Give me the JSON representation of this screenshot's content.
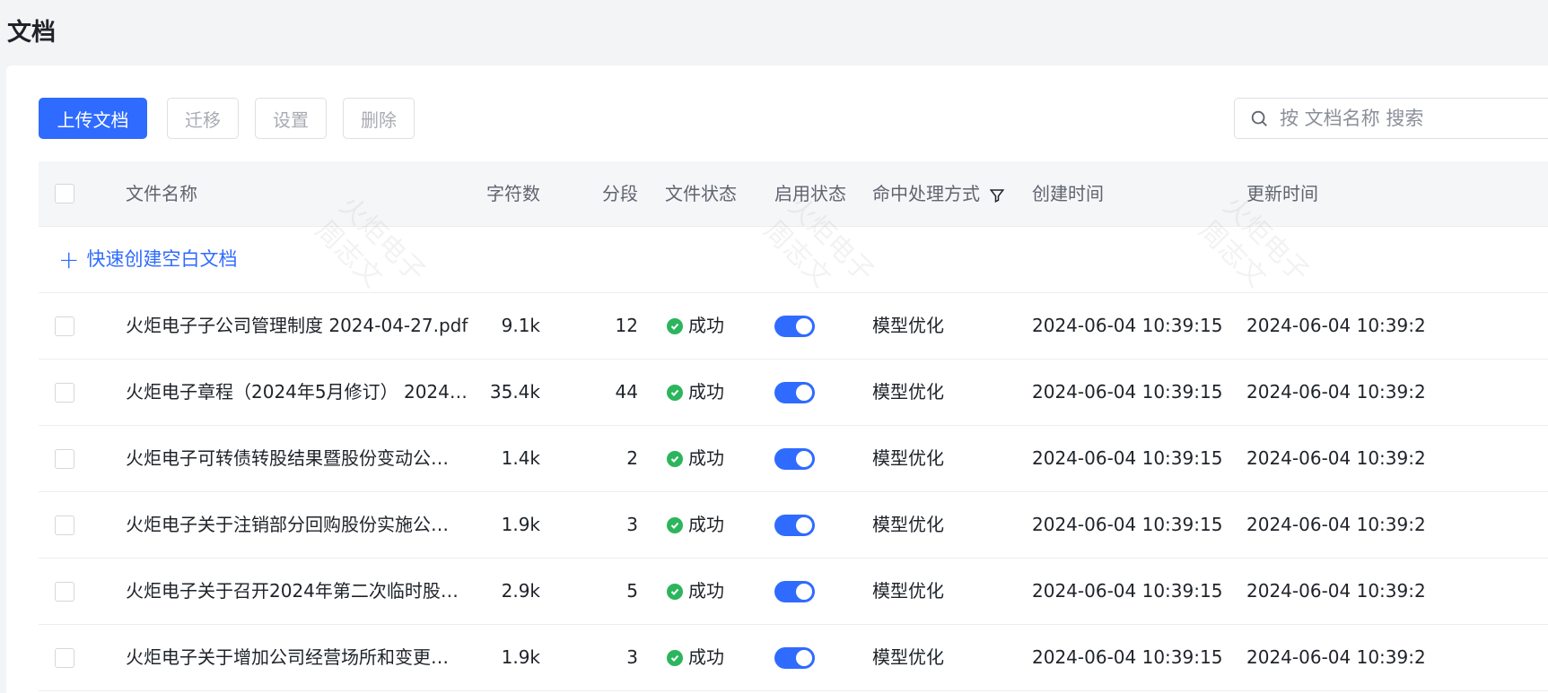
{
  "page": {
    "title": "文档"
  },
  "toolbar": {
    "upload_label": "上传文档",
    "migrate_label": "迁移",
    "settings_label": "设置",
    "delete_label": "删除"
  },
  "search": {
    "placeholder": "按 文档名称 搜索",
    "value": ""
  },
  "table": {
    "headers": {
      "name": "文件名称",
      "chars": "字符数",
      "segments": "分段",
      "file_status": "文件状态",
      "enable_status": "启用状态",
      "hit_method": "命中处理方式",
      "created": "创建时间",
      "updated": "更新时间"
    },
    "create_blank_label": "快速创建空白文档",
    "rows": [
      {
        "name": "火炬电子子公司管理制度 2024-04-27.pdf",
        "chars": "9.1k",
        "segments": "12",
        "status": "成功",
        "enabled": true,
        "method": "模型优化",
        "created": "2024-06-04 10:39:15",
        "updated": "2024-06-04 10:39:2"
      },
      {
        "name": "火炬电子章程（2024年5月修订） 2024…",
        "chars": "35.4k",
        "segments": "44",
        "status": "成功",
        "enabled": true,
        "method": "模型优化",
        "created": "2024-06-04 10:39:15",
        "updated": "2024-06-04 10:39:2"
      },
      {
        "name": "火炬电子可转债转股结果暨股份变动公…",
        "chars": "1.4k",
        "segments": "2",
        "status": "成功",
        "enabled": true,
        "method": "模型优化",
        "created": "2024-06-04 10:39:15",
        "updated": "2024-06-04 10:39:2"
      },
      {
        "name": "火炬电子关于注销部分回购股份实施公…",
        "chars": "1.9k",
        "segments": "3",
        "status": "成功",
        "enabled": true,
        "method": "模型优化",
        "created": "2024-06-04 10:39:15",
        "updated": "2024-06-04 10:39:2"
      },
      {
        "name": "火炬电子关于召开2024年第二次临时股…",
        "chars": "2.9k",
        "segments": "5",
        "status": "成功",
        "enabled": true,
        "method": "模型优化",
        "created": "2024-06-04 10:39:15",
        "updated": "2024-06-04 10:39:2"
      },
      {
        "name": "火炬电子关于增加公司经营场所和变更…",
        "chars": "1.9k",
        "segments": "3",
        "status": "成功",
        "enabled": true,
        "method": "模型优化",
        "created": "2024-06-04 10:39:15",
        "updated": "2024-06-04 10:39:2"
      }
    ]
  },
  "watermark": {
    "line1": "火炬电子",
    "line2": "周志文"
  },
  "colors": {
    "primary": "#2f6bff",
    "success": "#2db55d"
  }
}
